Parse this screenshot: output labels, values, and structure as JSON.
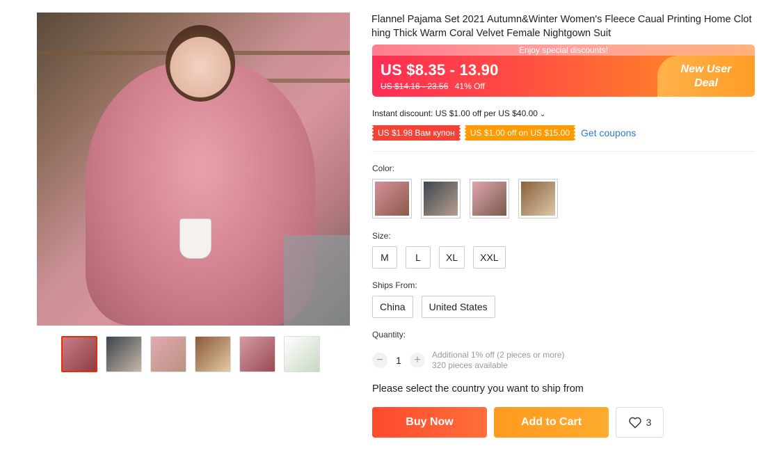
{
  "product": {
    "title": "Flannel Pajama Set 2021 Autumn&Winter Women's Fleece Caual Printing Home Clothing Thick Warm Coral Velvet Female Nightgown Suit"
  },
  "gallery": {
    "thumbnails": [
      {
        "name": "thumbnail-1",
        "colors": [
          "#c97c86",
          "#8e3f44"
        ],
        "active": true
      },
      {
        "name": "thumbnail-2",
        "colors": [
          "#3b4450",
          "#c7b7a5"
        ],
        "active": false
      },
      {
        "name": "thumbnail-3",
        "colors": [
          "#e3a9b1",
          "#b89280"
        ],
        "active": false
      },
      {
        "name": "thumbnail-4",
        "colors": [
          "#8a5a3a",
          "#e4c9a5"
        ],
        "active": false
      },
      {
        "name": "thumbnail-5",
        "colors": [
          "#d49aa4",
          "#9b4a52"
        ],
        "active": false
      },
      {
        "name": "thumbnail-6",
        "colors": [
          "#ffffff",
          "#c9d7c4"
        ],
        "active": false
      }
    ]
  },
  "pricing": {
    "promo_strip": "Enjoy special discounts!",
    "price_range": "US $8.35 - 13.90",
    "original_range": "US $14.16 - 23.56",
    "discount": "41% Off",
    "deal_line1": "New User",
    "deal_line2": "Deal"
  },
  "discounts": {
    "instant": "Instant discount: US $1.00 off per US $40.00",
    "coupon_red": "US $1.98 Вам купон",
    "coupon_orange": "US $1.00 off on US $15.00",
    "get_coupons": "Get coupons"
  },
  "options": {
    "color_label": "Color:",
    "colors": [
      {
        "name": "color-option-1",
        "colors": [
          "#d5909a",
          "#8c5b4a"
        ]
      },
      {
        "name": "color-option-2",
        "colors": [
          "#3c4652",
          "#b79f8c"
        ]
      },
      {
        "name": "color-option-3",
        "colors": [
          "#e0a4ad",
          "#7a5a4c"
        ]
      },
      {
        "name": "color-option-4",
        "colors": [
          "#8a5f3c",
          "#dcc8a8"
        ]
      }
    ],
    "size_label": "Size:",
    "sizes": [
      "M",
      "L",
      "XL",
      "XXL"
    ],
    "ships_label": "Ships From:",
    "ships_from": [
      "China",
      "United States"
    ],
    "quantity_label": "Quantity:",
    "quantity": "1",
    "qty_minus": "−",
    "qty_plus": "+",
    "quantity_note": "Additional 1% off (2 pieces or more)",
    "availability": "320 pieces available"
  },
  "ship_message": "Please select the country you want to ship from",
  "actions": {
    "buy_now": "Buy Now",
    "add_to_cart": "Add to Cart",
    "wishlist_count": "3"
  },
  "colors": {
    "accent": "#ff4a2f",
    "cart": "#ff9a1f",
    "link": "#2a7bd7"
  }
}
